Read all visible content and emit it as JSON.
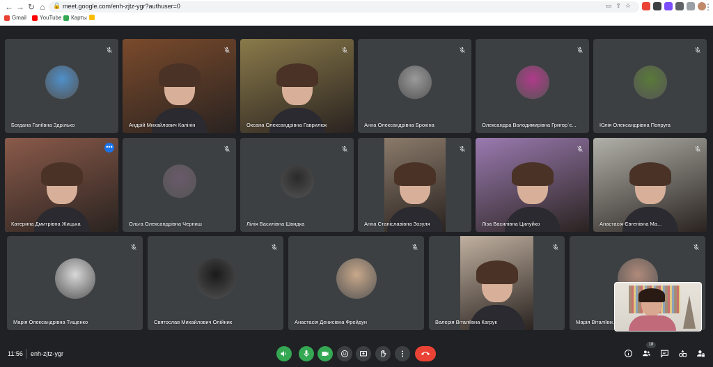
{
  "browser": {
    "url": "meet.google.com/enh-zjtz-ygr?authuser=0",
    "bookmarks": [
      {
        "label": "Gmail",
        "color": "#ea4335"
      },
      {
        "label": "YouTube",
        "color": "#ff0000"
      },
      {
        "label": "Карты",
        "color": "#34a853"
      }
    ]
  },
  "meeting": {
    "time": "11:56",
    "code": "enh-zjtz-ygr",
    "participant_count": "18"
  },
  "participants": [
    {
      "name": "Богдана Галіївна Здрілько",
      "kind": "avatar",
      "bg": "#4f8fc9"
    },
    {
      "name": "Андрій Михайлович Калінін",
      "kind": "video",
      "bg": "#7a4a2c"
    },
    {
      "name": "Оксана Олександрівна Гаврилюк",
      "kind": "video",
      "bg": "#8a7a4a"
    },
    {
      "name": "Анна Олександрівна Брохіна",
      "kind": "avatar",
      "bg": "#9a9a9a"
    },
    {
      "name": "Олександра Володимирівна Григор`є...",
      "kind": "avatar",
      "bg": "#b03a8a"
    },
    {
      "name": "Юлія Олександрівна Попруга",
      "kind": "avatar",
      "bg": "#5a7a3a"
    },
    {
      "name": "Катерина Дмитрівна Жицька",
      "kind": "video",
      "bg": "#8a5a4a"
    },
    {
      "name": "Ольга Олександрівна Черниш",
      "kind": "avatar",
      "bg": "#6a5a6a"
    },
    {
      "name": "Лілія Василівна Швидка",
      "kind": "avatar",
      "bg": "#2a2a2a"
    },
    {
      "name": "Анна Станіславівна Зозуля",
      "kind": "video",
      "bg": "#8a7a6a"
    },
    {
      "name": "Ліза Василівна Цилуйко",
      "kind": "video",
      "bg": "#9a7ab0"
    },
    {
      "name": "Анастасія Євгенівна Ма...",
      "kind": "video",
      "bg": "#b0b0a8"
    },
    {
      "name": "Марія Олександрівна Тищенко",
      "kind": "avatar",
      "bg": "#d8d8d8"
    },
    {
      "name": "Святослав Михайлович Олійник",
      "kind": "avatar",
      "bg": "#1a1a1a"
    },
    {
      "name": "Анастасія Денисівна Фрейдун",
      "kind": "avatar",
      "bg": "#c8a88a"
    },
    {
      "name": "Валерія Віталіївна Кагрук",
      "kind": "video",
      "bg": "#c0b0a0"
    },
    {
      "name": "Марія Віталіївн...",
      "kind": "avatar",
      "bg": "#b08a7a"
    }
  ],
  "self_view": {
    "bg": "#d8d4cc"
  },
  "controls": [
    {
      "name": "volume-button",
      "color": "green"
    },
    {
      "name": "mic-button",
      "color": "green"
    },
    {
      "name": "camera-button",
      "color": "green"
    },
    {
      "name": "emoji-button",
      "color": "gray"
    },
    {
      "name": "present-button",
      "color": "gray"
    },
    {
      "name": "raise-hand-button",
      "color": "gray"
    },
    {
      "name": "more-options-button",
      "color": "gray"
    },
    {
      "name": "leave-call-button",
      "color": "red"
    }
  ]
}
